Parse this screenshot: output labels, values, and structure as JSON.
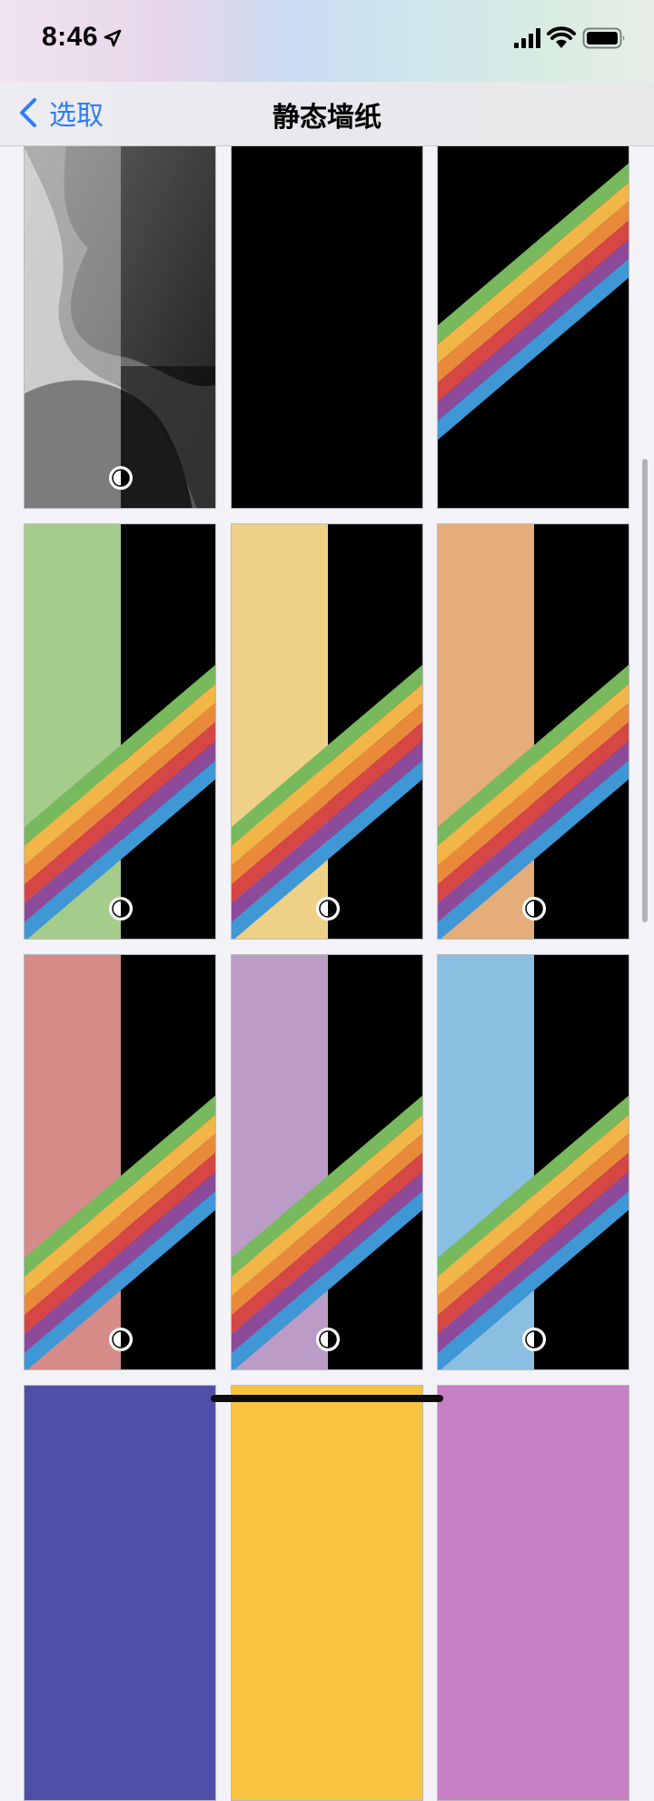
{
  "status": {
    "time": "8:46",
    "icons": [
      "location-arrow-icon",
      "signal-bars-icon",
      "wifi-icon",
      "battery-icon"
    ]
  },
  "nav": {
    "back_label": "选取",
    "title": "静态墙纸"
  },
  "colors": {
    "accent": "#2f7df6",
    "stripes": [
      "#78b95e",
      "#f1b548",
      "#e98a3a",
      "#d64645",
      "#8e4a9a",
      "#3f97d6"
    ],
    "solid_halves": [
      "#a6cc8c",
      "#efd087",
      "#e4ad79",
      "#d58b88",
      "#bb9cc6",
      "#8bbfe1"
    ]
  },
  "wallpapers": [
    {
      "type": "gray-waves",
      "dual_mode": true
    },
    {
      "type": "black",
      "dual_mode": false
    },
    {
      "type": "stripes",
      "color": null,
      "dual_mode": false
    },
    {
      "type": "split-stripes",
      "color": "#a6cc8c",
      "dual_mode": true
    },
    {
      "type": "split-stripes",
      "color": "#efd087",
      "dual_mode": true
    },
    {
      "type": "split-stripes",
      "color": "#e4ad79",
      "dual_mode": true
    },
    {
      "type": "split-stripes",
      "color": "#d58b88",
      "dual_mode": true
    },
    {
      "type": "split-stripes",
      "color": "#bb9cc6",
      "dual_mode": true
    },
    {
      "type": "split-stripes",
      "color": "#8bbfe1",
      "dual_mode": true
    },
    {
      "type": "solid",
      "color": "#4f4fa8",
      "dual_mode": false
    },
    {
      "type": "solid",
      "color": "#f7c341",
      "dual_mode": false
    },
    {
      "type": "solid",
      "color": "#c77ec2",
      "dual_mode": false
    }
  ]
}
